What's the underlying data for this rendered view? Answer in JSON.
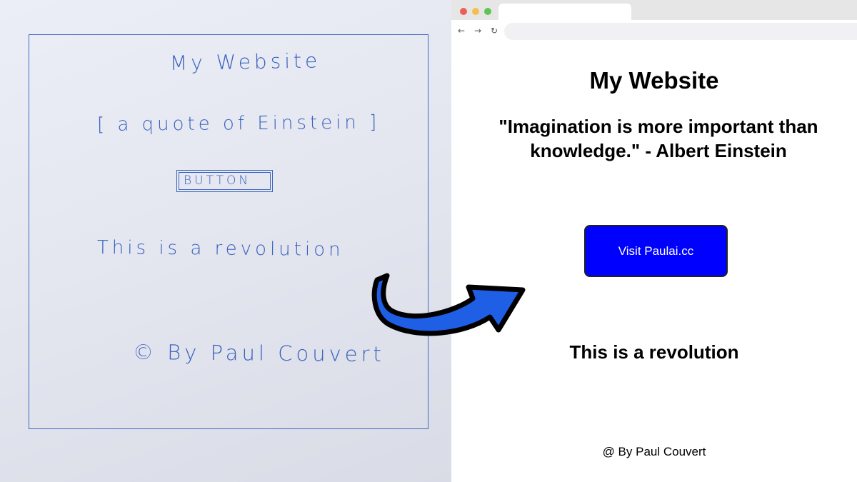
{
  "sketch": {
    "title": "My Website",
    "quote_placeholder": "[ a quote of Einstein ]",
    "button_label": "BUTTON",
    "tagline": "This is a revolution",
    "footer": "© By Paul Couvert"
  },
  "browser": {
    "traffic_lights": [
      "#ec5f57",
      "#f4bf4f",
      "#5fc454"
    ],
    "nav_icons": [
      "back-arrow-icon",
      "forward-arrow-icon",
      "reload-icon"
    ]
  },
  "site": {
    "title": "My Website",
    "quote": "\"Imagination is more important than knowledge.\" - Albert Einstein",
    "button_label": "Visit Paulai.cc",
    "tagline": "This is a revolution",
    "footer": "@ By Paul Couvert"
  },
  "colors": {
    "sketch_ink": "#3a62bd",
    "button_bg": "#0000ff",
    "arrow_fill": "#1f5fe6"
  }
}
